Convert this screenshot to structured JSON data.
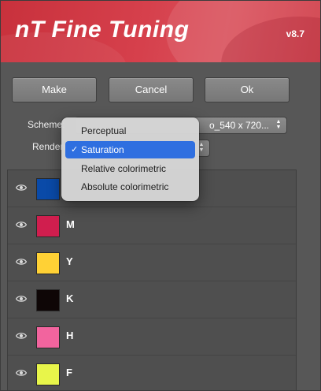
{
  "header": {
    "title": "nT Fine Tuning",
    "version": "v8.7"
  },
  "buttons": {
    "make": "Make",
    "cancel": "Cancel",
    "ok": "Ok"
  },
  "scheme": {
    "label": "Scheme:",
    "value": "o_540 x 720..."
  },
  "rendering": {
    "label": "Rendering:"
  },
  "menu": {
    "items": [
      {
        "label": "Perceptual",
        "selected": false
      },
      {
        "label": "Saturation",
        "selected": true
      },
      {
        "label": "Relative colorimetric",
        "selected": false
      },
      {
        "label": "Absolute colorimetric",
        "selected": false
      }
    ],
    "check_glyph": "✓"
  },
  "channels": [
    {
      "name": "",
      "color": "#0a4aa8"
    },
    {
      "name": "M",
      "color": "#d01e4e"
    },
    {
      "name": "Y",
      "color": "#ffd135"
    },
    {
      "name": "K",
      "color": "#0e0606"
    },
    {
      "name": "H",
      "color": "#f2649e"
    },
    {
      "name": "F",
      "color": "#e8f54a"
    }
  ],
  "icons": {
    "visibility": "eye-icon",
    "stepper": "up-down-chevron-icon"
  }
}
